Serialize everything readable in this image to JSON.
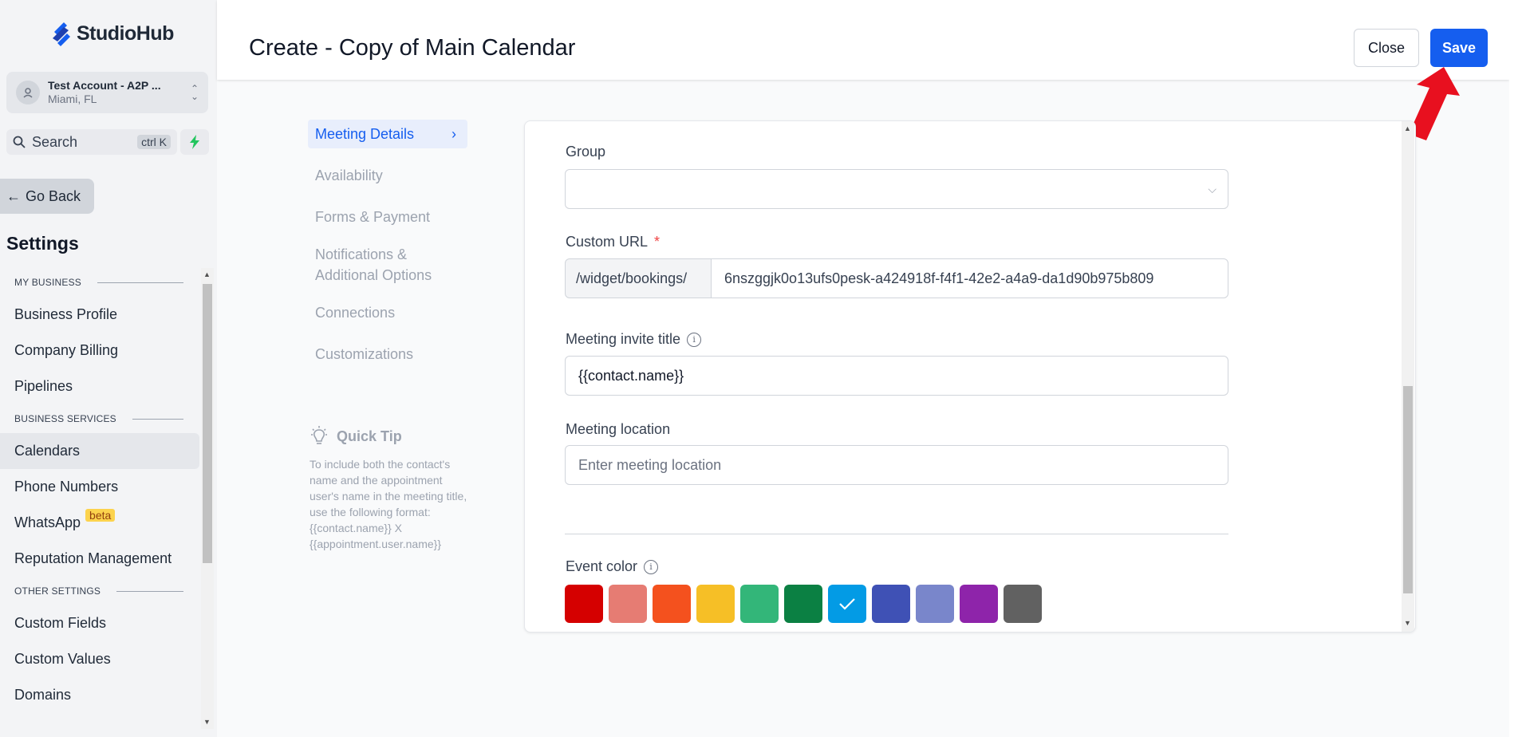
{
  "brand": {
    "name": "StudioHub"
  },
  "account": {
    "name": "Test Account - A2P ...",
    "location": "Miami, FL"
  },
  "search": {
    "label": "Search",
    "shortcut": "ctrl K"
  },
  "nav_back": {
    "label": "Go Back"
  },
  "settings_title": "Settings",
  "sidebar": {
    "sections": [
      {
        "title": "MY BUSINESS",
        "items": [
          "Business Profile",
          "Company Billing",
          "Pipelines"
        ]
      },
      {
        "title": "BUSINESS SERVICES",
        "items": [
          "Calendars",
          "Phone Numbers",
          "WhatsApp",
          "Reputation Management"
        ]
      },
      {
        "title": "OTHER SETTINGS",
        "items": [
          "Custom Fields",
          "Custom Values",
          "Domains"
        ]
      }
    ],
    "active_item": "Calendars",
    "whatsapp_badge": "beta"
  },
  "header": {
    "title": "Create - Copy of Main Calendar",
    "close_label": "Close",
    "save_label": "Save"
  },
  "tabs": [
    "Meeting Details",
    "Availability",
    "Forms & Payment",
    "Notifications & Additional Options",
    "Connections",
    "Customizations"
  ],
  "active_tab": "Meeting Details",
  "quick_tip": {
    "title": "Quick Tip",
    "body": "To include both the contact's name and the appointment user's name in the meeting title, use the following format: {{contact.name}} X {{appointment.user.name}}"
  },
  "form": {
    "group": {
      "label": "Group",
      "value": ""
    },
    "custom_url": {
      "label": "Custom URL",
      "required_mark": "*",
      "prefix": "/widget/bookings/",
      "value": "6nszggjk0o13ufs0pesk-a424918f-f4f1-42e2-a4a9-da1d90b975b809"
    },
    "invite_title": {
      "label": "Meeting invite title",
      "value": "{{contact.name}}"
    },
    "location": {
      "label": "Meeting location",
      "placeholder": "Enter meeting location"
    },
    "event_color": {
      "label": "Event color",
      "colors": [
        "#d50000",
        "#e67c73",
        "#f4511e",
        "#f6bf26",
        "#33b679",
        "#0b8043",
        "#039be5",
        "#3f51b5",
        "#7986cb",
        "#8e24aa",
        "#616161"
      ],
      "selected_index": 6
    }
  },
  "colors": {
    "accent": "#155eef",
    "annotation_arrow": "#e8101f"
  }
}
